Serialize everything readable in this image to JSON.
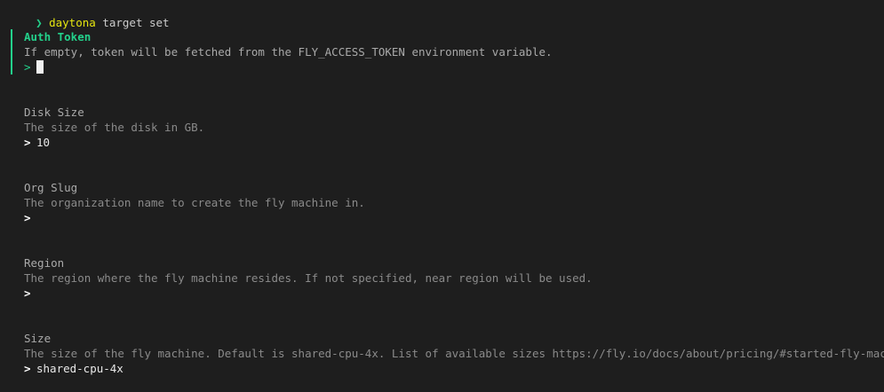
{
  "command": {
    "prompt_symbol": "❯",
    "name": "daytona",
    "args": " target set"
  },
  "fields": [
    {
      "title": "Auth Token",
      "description": "If empty, token will be fetched from the FLY_ACCESS_TOKEN environment variable.",
      "prompt": ">",
      "value": ""
    },
    {
      "title": "Disk Size",
      "description": "The size of the disk in GB.",
      "prompt": ">",
      "value": "10"
    },
    {
      "title": "Org Slug",
      "description": "The organization name to create the fly machine in.",
      "prompt": ">",
      "value": ""
    },
    {
      "title": "Region",
      "description": "The region where the fly machine resides. If not specified, near region will be used.",
      "prompt": ">",
      "value": ""
    },
    {
      "title": "Size",
      "description": "The size of the fly machine. Default is shared-cpu-4x. List of available sizes https://fly.io/docs/about/pricing/#started-fly-machines",
      "prompt": ">",
      "value": "shared-cpu-4x"
    }
  ],
  "colors": {
    "background": "#1e1e1e",
    "accent_green": "#23d18b",
    "command_yellow": "#e5e510",
    "text_gray": "#aaaaaa"
  }
}
